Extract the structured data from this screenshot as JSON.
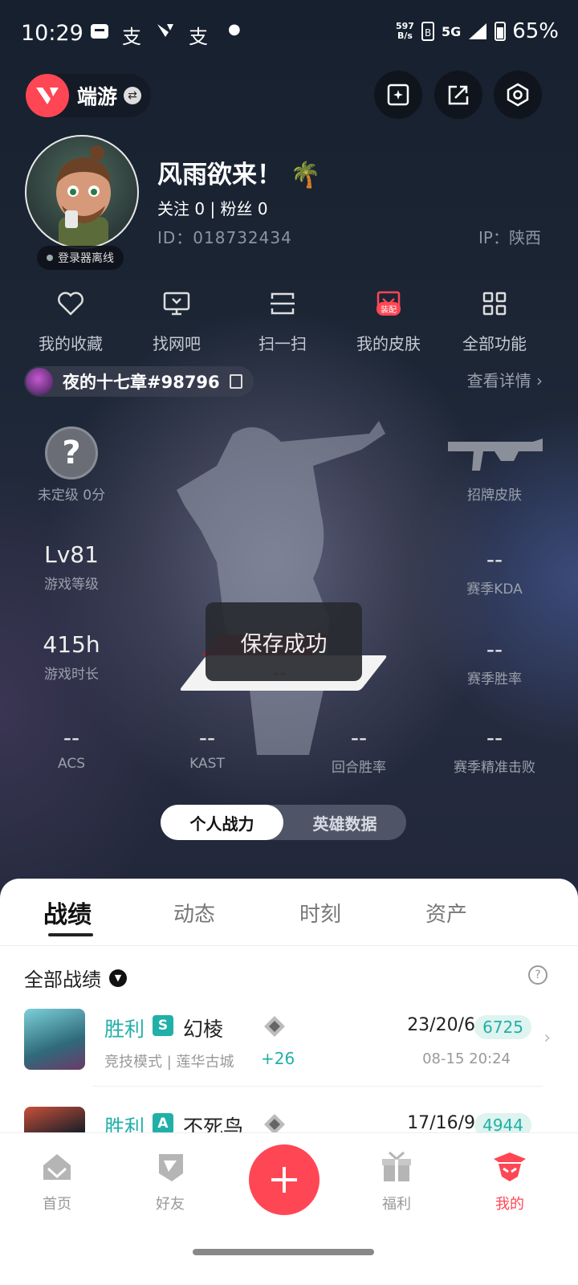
{
  "status_bar": {
    "time": "10:29",
    "notif_icons": [
      "message-icon",
      "alipay-icon",
      "valorant-icon",
      "alipay-icon",
      "dot-icon"
    ],
    "net_speed_top": "597",
    "net_speed_bottom": "B/s",
    "network": "5G",
    "battery": "65%"
  },
  "top": {
    "game_label": "端游"
  },
  "profile": {
    "nickname": "风雨欲来！",
    "emoji": "🌴",
    "follow_text": "关注 0  |  粉丝 0",
    "id_text": "ID：018732434",
    "ip_text": "IP：陕西",
    "offline_label": "登录器离线"
  },
  "quick_functions": [
    {
      "label": "我的收藏",
      "icon": "heart-icon"
    },
    {
      "label": "找网吧",
      "icon": "monitor-icon"
    },
    {
      "label": "扫一扫",
      "icon": "scan-icon"
    },
    {
      "label": "我的皮肤",
      "icon": "skin-icon",
      "badge": "装配"
    },
    {
      "label": "全部功能",
      "icon": "grid-icon"
    }
  ],
  "riot": {
    "name": "夜的十七章#98796",
    "view_detail": "查看详情 ›"
  },
  "stats": {
    "rank_label": "未定级 0分",
    "skin_label": "招牌皮肤",
    "level_value": "Lv81",
    "level_label": "游戏等级",
    "kda_value": "--",
    "kda_label": "赛季KDA",
    "playtime_value": "415h",
    "playtime_label": "游戏时长",
    "winrate_value": "--",
    "winrate_label": "赛季胜率",
    "acs_value": "--",
    "acs_label": "ACS",
    "kast_value": "--",
    "kast_label": "KAST",
    "round_value": "--",
    "round_label": "回合胜率",
    "precise_value": "--",
    "precise_label": "赛季精准击败",
    "center_value": "--"
  },
  "toast": {
    "text": "保存成功"
  },
  "toggle": {
    "on": "个人战力",
    "off": "英雄数据"
  },
  "tabs": [
    "战绩",
    "动态",
    "时刻",
    "资产"
  ],
  "filter": {
    "label": "全部战绩"
  },
  "matches": [
    {
      "result": "胜利",
      "tier": "S",
      "agent": "幻棱",
      "mode": "竞技模式 | 莲华古城",
      "rr": "+26",
      "kda": "23/20/6",
      "acs": "6725",
      "date": "08-15 20:24",
      "avatar_color": "#3f8fa0"
    },
    {
      "result": "胜利",
      "tier": "A",
      "agent": "不死鸟",
      "mode": "",
      "rr": "",
      "kda": "17/16/9",
      "acs": "4944",
      "date": "",
      "avatar_color": "#2e6b8a"
    }
  ],
  "bottom_nav": [
    {
      "label": "首页",
      "icon": "home-icon"
    },
    {
      "label": "好友",
      "icon": "friends-icon"
    },
    {
      "label": "福利",
      "icon": "gift-icon"
    },
    {
      "label": "我的",
      "icon": "profile-icon"
    }
  ],
  "colors": {
    "accent": "#ff4655",
    "win": "#20b0a8"
  }
}
